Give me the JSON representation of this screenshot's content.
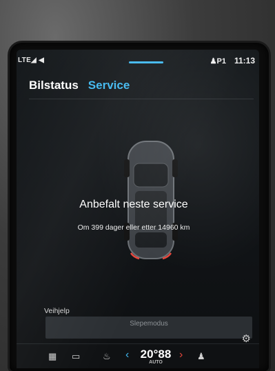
{
  "status_bar": {
    "signal": "LTE◢ ◀",
    "profile": "P1",
    "time": "11:13"
  },
  "tabs": [
    {
      "label": "Bilstatus",
      "active": false
    },
    {
      "label": "Service",
      "active": true
    }
  ],
  "service": {
    "headline": "Anbefalt neste service",
    "detail": "Om 399 dager eller etter 14960 km"
  },
  "assistance": {
    "section_label": "Veihjelp",
    "tow_button": "Slepemodus"
  },
  "climate": {
    "temperature": "20°",
    "temperature_unit": "88",
    "mode": "AUTO"
  },
  "icons": {
    "home": "grid-icon",
    "camera": "camera-icon",
    "seat_left": "seat-heat-icon",
    "seat_right": "seat-icon",
    "settings": "gear-icon"
  },
  "colors": {
    "accent": "#3fb8f0",
    "warm": "#e6463c",
    "background": "#111417"
  }
}
